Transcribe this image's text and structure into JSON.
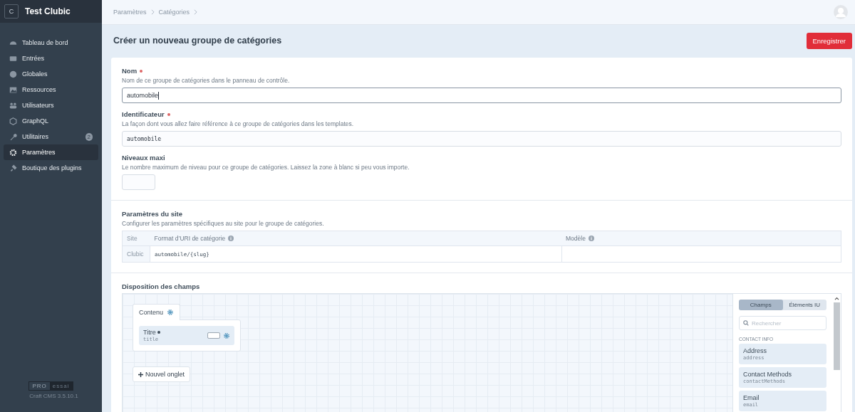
{
  "sidebar": {
    "site_initial": "C",
    "site_name": "Test Clubic",
    "items": [
      {
        "label": "Tableau de bord",
        "selected": false
      },
      {
        "label": "Entrées",
        "selected": false
      },
      {
        "label": "Globales",
        "selected": false
      },
      {
        "label": "Ressources",
        "selected": false
      },
      {
        "label": "Utilisateurs",
        "selected": false
      },
      {
        "label": "GraphQL",
        "selected": false
      },
      {
        "label": "Utilitaires",
        "selected": false,
        "badge": "2"
      },
      {
        "label": "Paramètres",
        "selected": true
      },
      {
        "label": "Boutique des plugins",
        "selected": false
      }
    ],
    "edition": {
      "pro": "PRO",
      "trial": "essai"
    },
    "version": "Craft CMS 3.5.10.1"
  },
  "breadcrumbs": [
    "Paramètres",
    "Catégories"
  ],
  "page_title": "Créer un nouveau groupe de catégories",
  "save_button": "Enregistrer",
  "fields": [
    {
      "label": "Nom",
      "required": true,
      "instructions": "Nom de ce groupe de catégories dans le panneau de contrôle.",
      "value": "automobile",
      "kind": "text",
      "focused": true
    },
    {
      "label": "Identificateur",
      "required": true,
      "instructions": "La façon dont vous allez faire référence à ce groupe de catégories dans les templates.",
      "value": "automobile",
      "kind": "code",
      "focused": false
    },
    {
      "label": "Niveaux maxi",
      "required": false,
      "instructions": "Le nombre maximum de niveau pour ce groupe de catégories. Laissez la zone à blanc si peu vous importe.",
      "kind": "small",
      "focused": false
    }
  ],
  "site_settings": {
    "label": "Paramètres du site",
    "instructions": "Configurer les paramètres spécifiques au site pour le groupe de catégories.",
    "columns": [
      {
        "label": "Site",
        "info": false
      },
      {
        "label": "Format d’URI de catégorie",
        "info": true
      },
      {
        "label": "Modèle",
        "info": true
      }
    ],
    "rows": [
      {
        "site": "Clubic",
        "uri_format": "automobile/{slug}"
      }
    ]
  },
  "field_layout": {
    "label": "Disposition des champs",
    "tabs": [
      {
        "name": "Contenu",
        "fields": [
          {
            "name": "Titre",
            "handle": "title",
            "required": true
          }
        ]
      }
    ],
    "new_tab_button": "Nouvel onglet",
    "library_tabs": [
      {
        "label": "Champs",
        "selected": true
      },
      {
        "label": "Éléments IU",
        "selected": false
      }
    ],
    "search": {
      "placeholder": "Rechercher"
    },
    "group": "CONTACT INFO",
    "available": [
      {
        "name": "Address",
        "handle": "address"
      },
      {
        "name": "Contact Methods",
        "handle": "contactMethods"
      },
      {
        "name": "Email",
        "handle": "email"
      }
    ]
  }
}
